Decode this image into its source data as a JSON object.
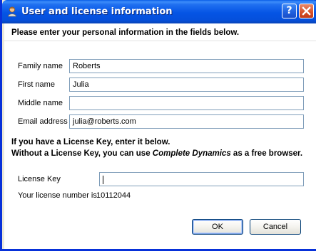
{
  "window": {
    "title": "User and license information",
    "help_glyph": "?",
    "close_glyph": "X",
    "app_icon": "user-icon"
  },
  "form": {
    "heading": "Please enter your personal information in the fields below.",
    "fields": [
      {
        "label": "Family name",
        "value": "Roberts"
      },
      {
        "label": "First name",
        "value": "Julia"
      },
      {
        "label": "Middle name",
        "value": ""
      },
      {
        "label": "Email address",
        "value": "julia@roberts.com"
      }
    ]
  },
  "license": {
    "line1": "If you have a License Key, enter it below.",
    "line2_prefix": "Without a License Key, you can use ",
    "line2_product": "Complete Dynamics",
    "line2_suffix": " as a free browser.",
    "key_label": "License Key",
    "key_value": "",
    "number_label": "Your license number is",
    "number_value": "10112044"
  },
  "buttons": {
    "ok": "OK",
    "cancel": "Cancel"
  },
  "colors": {
    "titlebar": "#0554e4",
    "frame": "#0831d9",
    "close_button": "#d6502a"
  }
}
